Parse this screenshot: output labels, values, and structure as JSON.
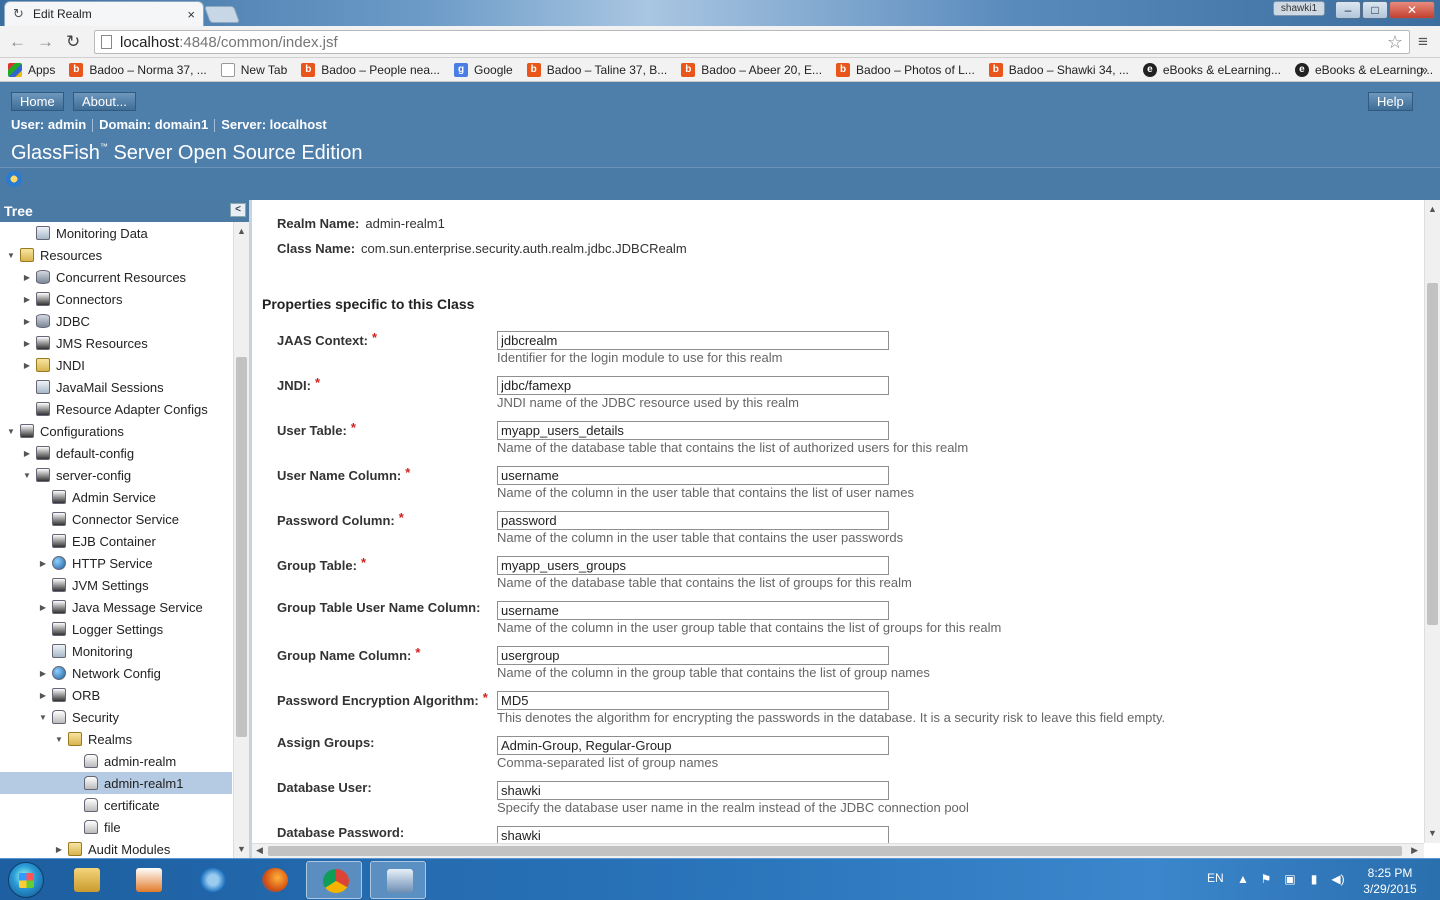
{
  "browser": {
    "tab_title": "Edit Realm",
    "user_chip": "shawki1",
    "url_host": "localhost",
    "url_path": ":4848/common/index.jsf",
    "bookmarks": [
      {
        "label": "Apps",
        "icon": "apps-icon"
      },
      {
        "label": "Badoo – Norma 37, ...",
        "icon": "badoo-icon"
      },
      {
        "label": "New Tab",
        "icon": "page-icon"
      },
      {
        "label": "Badoo – People nea...",
        "icon": "badoo-icon"
      },
      {
        "label": "Google",
        "icon": "google-icon"
      },
      {
        "label": "Badoo – Taline 37, B...",
        "icon": "badoo-icon"
      },
      {
        "label": "Badoo – Abeer 20, E...",
        "icon": "badoo-icon"
      },
      {
        "label": "Badoo – Photos of L...",
        "icon": "badoo-icon"
      },
      {
        "label": "Badoo – Shawki 34, ...",
        "icon": "badoo-icon"
      },
      {
        "label": "eBooks & eLearning...",
        "icon": "ebook-icon"
      },
      {
        "label": "eBooks & eLearning...",
        "icon": "ebook-icon"
      }
    ],
    "bookmarks_more": "»"
  },
  "masthead": {
    "home": "Home",
    "about": "About...",
    "help": "Help",
    "user": "User: admin",
    "domain": "Domain: domain1",
    "server": "Server: localhost",
    "title": "GlassFish",
    "title_tm": "™",
    "title_rest": " Server Open Source Edition"
  },
  "tree": {
    "header": "Tree",
    "items": [
      {
        "label": "Monitoring Data",
        "depth": 1,
        "twisty": "",
        "icon": "monitor"
      },
      {
        "label": "Resources",
        "depth": 0,
        "twisty": "▼",
        "icon": "folder"
      },
      {
        "label": "Concurrent Resources",
        "depth": 1,
        "twisty": "▶",
        "icon": "db"
      },
      {
        "label": "Connectors",
        "depth": 1,
        "twisty": "▶",
        "icon": "cfg"
      },
      {
        "label": "JDBC",
        "depth": 1,
        "twisty": "▶",
        "icon": "db"
      },
      {
        "label": "JMS Resources",
        "depth": 1,
        "twisty": "▶",
        "icon": "cfg"
      },
      {
        "label": "JNDI",
        "depth": 1,
        "twisty": "▶",
        "icon": "folder"
      },
      {
        "label": "JavaMail Sessions",
        "depth": 1,
        "twisty": "",
        "icon": "mail"
      },
      {
        "label": "Resource Adapter Configs",
        "depth": 1,
        "twisty": "",
        "icon": "cfg"
      },
      {
        "label": "Configurations",
        "depth": 0,
        "twisty": "▼",
        "icon": "cfg"
      },
      {
        "label": "default-config",
        "depth": 1,
        "twisty": "▶",
        "icon": "cfg"
      },
      {
        "label": "server-config",
        "depth": 1,
        "twisty": "▼",
        "icon": "cfg"
      },
      {
        "label": "Admin Service",
        "depth": 2,
        "twisty": "",
        "icon": "cfg"
      },
      {
        "label": "Connector Service",
        "depth": 2,
        "twisty": "",
        "icon": "cfg"
      },
      {
        "label": "EJB Container",
        "depth": 2,
        "twisty": "",
        "icon": "cfg"
      },
      {
        "label": "HTTP Service",
        "depth": 2,
        "twisty": "▶",
        "icon": "globe"
      },
      {
        "label": "JVM Settings",
        "depth": 2,
        "twisty": "",
        "icon": "cfg"
      },
      {
        "label": "Java Message Service",
        "depth": 2,
        "twisty": "▶",
        "icon": "cfg"
      },
      {
        "label": "Logger Settings",
        "depth": 2,
        "twisty": "",
        "icon": "cfg"
      },
      {
        "label": "Monitoring",
        "depth": 2,
        "twisty": "",
        "icon": "monitor"
      },
      {
        "label": "Network Config",
        "depth": 2,
        "twisty": "▶",
        "icon": "globe"
      },
      {
        "label": "ORB",
        "depth": 2,
        "twisty": "▶",
        "icon": "cfg"
      },
      {
        "label": "Security",
        "depth": 2,
        "twisty": "▼",
        "icon": "lock"
      },
      {
        "label": "Realms",
        "depth": 3,
        "twisty": "▼",
        "icon": "folder"
      },
      {
        "label": "admin-realm",
        "depth": 4,
        "twisty": "",
        "icon": "lock"
      },
      {
        "label": "admin-realm1",
        "depth": 4,
        "twisty": "",
        "icon": "lock",
        "selected": true
      },
      {
        "label": "certificate",
        "depth": 4,
        "twisty": "",
        "icon": "lock"
      },
      {
        "label": "file",
        "depth": 4,
        "twisty": "",
        "icon": "lock"
      },
      {
        "label": "Audit Modules",
        "depth": 3,
        "twisty": "▶",
        "icon": "folder"
      }
    ]
  },
  "realm": {
    "name_label": "Realm Name:",
    "name_value": "admin-realm1",
    "class_label": "Class Name:",
    "class_value": "com.sun.enterprise.security.auth.realm.jdbc.JDBCRealm",
    "section_title": "Properties specific to this Class"
  },
  "properties": [
    {
      "label": "JAAS Context:",
      "required": true,
      "value": "jdbcrealm",
      "help": "Identifier for the login module to use for this realm"
    },
    {
      "label": "JNDI:",
      "required": true,
      "value": "jdbc/famexp",
      "help": "JNDI name of the JDBC resource used by this realm"
    },
    {
      "label": "User Table:",
      "required": true,
      "value": "myapp_users_details",
      "help": "Name of the database table that contains the list of authorized users for this realm"
    },
    {
      "label": "User Name Column:",
      "required": true,
      "value": "username",
      "help": "Name of the column in the user table that contains the list of user names"
    },
    {
      "label": "Password Column:",
      "required": true,
      "value": "password",
      "help": "Name of the column in the user table that contains the user passwords"
    },
    {
      "label": "Group Table:",
      "required": true,
      "value": "myapp_users_groups",
      "help": "Name of the database table that contains the list of groups for this realm"
    },
    {
      "label": "Group Table User Name Column:",
      "required": false,
      "value": "username",
      "help": "Name of the column in the user group table that contains the list of groups for this realm"
    },
    {
      "label": "Group Name Column:",
      "required": true,
      "value": "usergroup",
      "help": "Name of the column in the group table that contains the list of group names"
    },
    {
      "label": "Password Encryption Algorithm:",
      "required": true,
      "value": "MD5",
      "help": "This denotes the algorithm for encrypting the passwords in the database. It is a security risk to leave this field empty."
    },
    {
      "label": "Assign Groups:",
      "required": false,
      "value": "Admin-Group, Regular-Group",
      "help": "Comma-separated list of group names"
    },
    {
      "label": "Database User:",
      "required": false,
      "value": "shawki",
      "help": "Specify the database user name in the realm instead of the JDBC connection pool"
    },
    {
      "label": "Database Password:",
      "required": false,
      "value": "shawki",
      "help": ""
    }
  ],
  "required_marker": "*",
  "taskbar": {
    "lang": "EN",
    "time": "8:25 PM",
    "date": "3/29/2015"
  }
}
